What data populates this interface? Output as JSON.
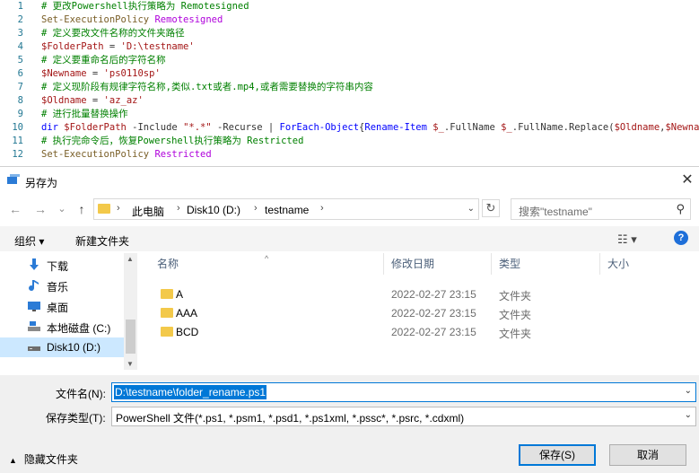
{
  "editor": {
    "lines": [
      {
        "num": "1",
        "parts": [
          {
            "t": "# 更改Powershell执行策略为 Remotesigned",
            "c": "c-comment"
          }
        ]
      },
      {
        "num": "2",
        "parts": [
          {
            "t": "Set-ExecutionPolicy ",
            "c": "c-cmd"
          },
          {
            "t": "Remotesigned",
            "c": "c-arg"
          }
        ]
      },
      {
        "num": "3",
        "parts": [
          {
            "t": "# 定义要改文件名称的文件夹路径",
            "c": "c-comment"
          }
        ]
      },
      {
        "num": "4",
        "parts": [
          {
            "t": "$FolderPath",
            "c": "c-var"
          },
          {
            "t": " = ",
            "c": "c-plain"
          },
          {
            "t": "'D:\\testname'",
            "c": "c-str"
          }
        ]
      },
      {
        "num": "5",
        "parts": [
          {
            "t": "# 定义要重命名后的字符名称",
            "c": "c-comment"
          }
        ]
      },
      {
        "num": "6",
        "parts": [
          {
            "t": "$Newname",
            "c": "c-var"
          },
          {
            "t": " = ",
            "c": "c-plain"
          },
          {
            "t": "'ps0110sp'",
            "c": "c-str"
          }
        ]
      },
      {
        "num": "7",
        "parts": [
          {
            "t": "# 定义现阶段有规律字符名称,类似.txt或者.mp4,或者需要替换的字符串内容",
            "c": "c-comment"
          }
        ]
      },
      {
        "num": "8",
        "parts": [
          {
            "t": "$Oldname",
            "c": "c-var"
          },
          {
            "t": " = ",
            "c": "c-plain"
          },
          {
            "t": "'az_az'",
            "c": "c-str"
          }
        ]
      },
      {
        "num": "9",
        "parts": [
          {
            "t": "# 进行批量替换操作",
            "c": "c-comment"
          }
        ]
      },
      {
        "num": "10",
        "parts": [
          {
            "t": "dir ",
            "c": "c-kw"
          },
          {
            "t": "$FolderPath",
            "c": "c-var"
          },
          {
            "t": " -Include ",
            "c": "c-plain"
          },
          {
            "t": "\"*.*\"",
            "c": "c-str"
          },
          {
            "t": " -Recurse | ",
            "c": "c-plain"
          },
          {
            "t": "ForEach-Object",
            "c": "c-kw"
          },
          {
            "t": "{",
            "c": "c-plain"
          },
          {
            "t": "Rename-Item ",
            "c": "c-kw"
          },
          {
            "t": "$_",
            "c": "c-var"
          },
          {
            "t": ".FullName ",
            "c": "c-plain"
          },
          {
            "t": "$_",
            "c": "c-var"
          },
          {
            "t": ".FullName.Replace(",
            "c": "c-plain"
          },
          {
            "t": "$Oldname",
            "c": "c-var"
          },
          {
            "t": ",",
            "c": "c-plain"
          },
          {
            "t": "$Newname",
            "c": "c-var"
          },
          {
            "t": ")}",
            "c": "c-plain"
          }
        ]
      },
      {
        "num": "11",
        "parts": [
          {
            "t": "# 执行完命令后，恢复Powershell执行策略为 Restricted",
            "c": "c-comment"
          }
        ]
      },
      {
        "num": "12",
        "parts": [
          {
            "t": "Set-ExecutionPolicy ",
            "c": "c-cmd"
          },
          {
            "t": "Restricted",
            "c": "c-arg"
          }
        ]
      }
    ]
  },
  "dialog": {
    "title": "另存为",
    "close_glyph": "✕",
    "nav": {
      "back": "←",
      "forward": "→",
      "dropdown": "⌄",
      "up": "↑",
      "refresh": "↻"
    },
    "address": {
      "segments": [
        "此电脑",
        "Disk10 (D:)",
        "testname"
      ],
      "sep": "›"
    },
    "search_placeholder": "搜索\"testname\"",
    "toolbar": {
      "organize": "组织 ▾",
      "new_folder": "新建文件夹",
      "view_glyph": "☷ ▾",
      "help": "?"
    },
    "nav_pane": [
      {
        "label": "下载",
        "icon": "download-icon"
      },
      {
        "label": "音乐",
        "icon": "music-icon"
      },
      {
        "label": "桌面",
        "icon": "desktop-icon"
      },
      {
        "label": "本地磁盘 (C:)",
        "icon": "drive-icon"
      },
      {
        "label": "Disk10 (D:)",
        "icon": "drive-icon",
        "selected": true
      }
    ],
    "columns": {
      "name": "名称",
      "modified": "修改日期",
      "type": "类型",
      "size": "大小"
    },
    "files": [
      {
        "name": "A",
        "modified": "2022-02-27 23:15",
        "type": "文件夹"
      },
      {
        "name": "AAA",
        "modified": "2022-02-27 23:15",
        "type": "文件夹"
      },
      {
        "name": "BCD",
        "modified": "2022-02-27 23:15",
        "type": "文件夹"
      }
    ],
    "filename_label": "文件名(N):",
    "filename_value": "D:\\testname\\folder_rename.ps1",
    "filetype_label": "保存类型(T):",
    "filetype_value": "PowerShell 文件(*.ps1, *.psm1, *.psd1, *.ps1xml, *.pssc*, *.psrc, *.cdxml)",
    "hide_folders": "隐藏文件夹",
    "save_button": "保存(S)",
    "cancel_button": "取消"
  }
}
